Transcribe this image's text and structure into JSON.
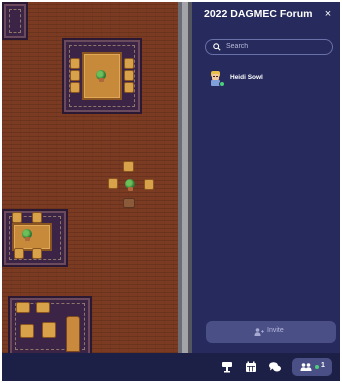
{
  "panel": {
    "title": "2022 DAGMEC Forum",
    "close_label": "×",
    "search": {
      "placeholder": "Search"
    },
    "members": [
      {
        "name": "Heidi Sowl",
        "status": "online"
      }
    ],
    "invite_label": "Invite"
  },
  "bottom_bar": {
    "icons": [
      "map-pin-icon",
      "calendar-icon",
      "chat-icon",
      "people-icon"
    ],
    "participant_count": "1"
  },
  "colors": {
    "panel_bg": "#262a5c",
    "floor": "#7b3b22",
    "online": "#4ad07a",
    "button_bg": "#4a4f86"
  }
}
